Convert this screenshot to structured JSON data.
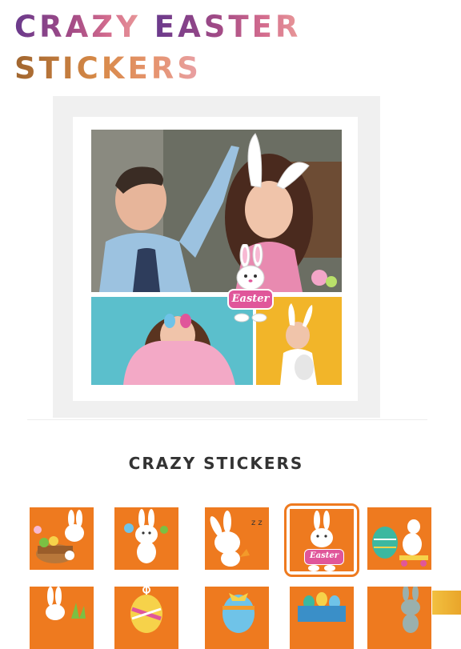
{
  "header": {
    "title_word1": "CRAZY",
    "title_word2": "EASTER",
    "title_word3": "STICKERS"
  },
  "canvas": {
    "easter_sticker_label": "Easter"
  },
  "stickers_section": {
    "title": "CRAZY STICKERS",
    "selected_index": 3,
    "items": [
      {
        "icon": "bunny-basket-icon"
      },
      {
        "icon": "bunny-waving-icon"
      },
      {
        "icon": "bunny-sleeping-icon"
      },
      {
        "icon": "bunny-easter-sign-icon",
        "label": "Easter"
      },
      {
        "icon": "bunny-egg-cart-icon"
      },
      {
        "icon": "bunny-grass-icon"
      },
      {
        "icon": "hanging-egg-icon"
      },
      {
        "icon": "egg-bow-icon"
      },
      {
        "icon": "egg-basket-icon"
      },
      {
        "icon": "grey-bunny-icon"
      }
    ]
  },
  "colors": {
    "sticker_bg": "#ee7a1f",
    "easter_pink": "#e0569a",
    "title_text": "#333333"
  }
}
